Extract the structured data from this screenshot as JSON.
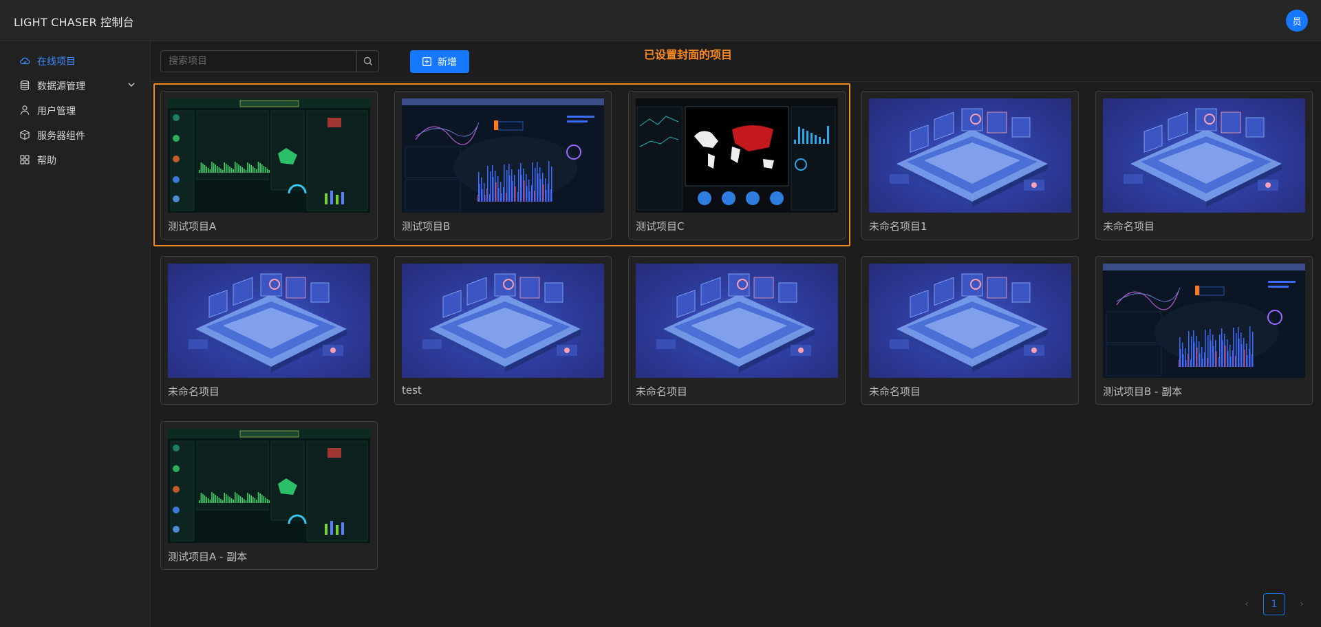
{
  "app": {
    "title": "LIGHT CHASER 控制台",
    "avatar_text": "员"
  },
  "sidebar": {
    "items": [
      {
        "label": "在线项目",
        "icon": "cloud-icon",
        "active": true
      },
      {
        "label": "数据源管理",
        "icon": "database-icon",
        "expandable": true
      },
      {
        "label": "用户管理",
        "icon": "user-icon"
      },
      {
        "label": "服务器组件",
        "icon": "cube-icon"
      },
      {
        "label": "帮助",
        "icon": "grid-icon"
      }
    ]
  },
  "toolbar": {
    "search_placeholder": "搜索项目",
    "add_label": "新增"
  },
  "annotation": {
    "text": "已设置封面的项目",
    "color": "#ff8a1f"
  },
  "projects": [
    {
      "name": "测试项目A",
      "cover": "dashboard-a"
    },
    {
      "name": "测试项目B",
      "cover": "dashboard-b"
    },
    {
      "name": "测试项目C",
      "cover": "dashboard-c"
    },
    {
      "name": "未命名项目1",
      "cover": "default"
    },
    {
      "name": "未命名项目",
      "cover": "default"
    },
    {
      "name": "未命名项目",
      "cover": "default"
    },
    {
      "name": "test",
      "cover": "default"
    },
    {
      "name": "未命名项目",
      "cover": "default"
    },
    {
      "name": "未命名项目",
      "cover": "default"
    },
    {
      "name": "测试项目B - 副本",
      "cover": "dashboard-b"
    },
    {
      "name": "测试项目A - 副本",
      "cover": "dashboard-a"
    }
  ],
  "pagination": {
    "current_page": "1",
    "prev_symbol": "‹",
    "next_symbol": "›"
  },
  "colors": {
    "accent": "#1677ff",
    "highlight": "#f08c1c",
    "background": "#1d1d1d"
  }
}
